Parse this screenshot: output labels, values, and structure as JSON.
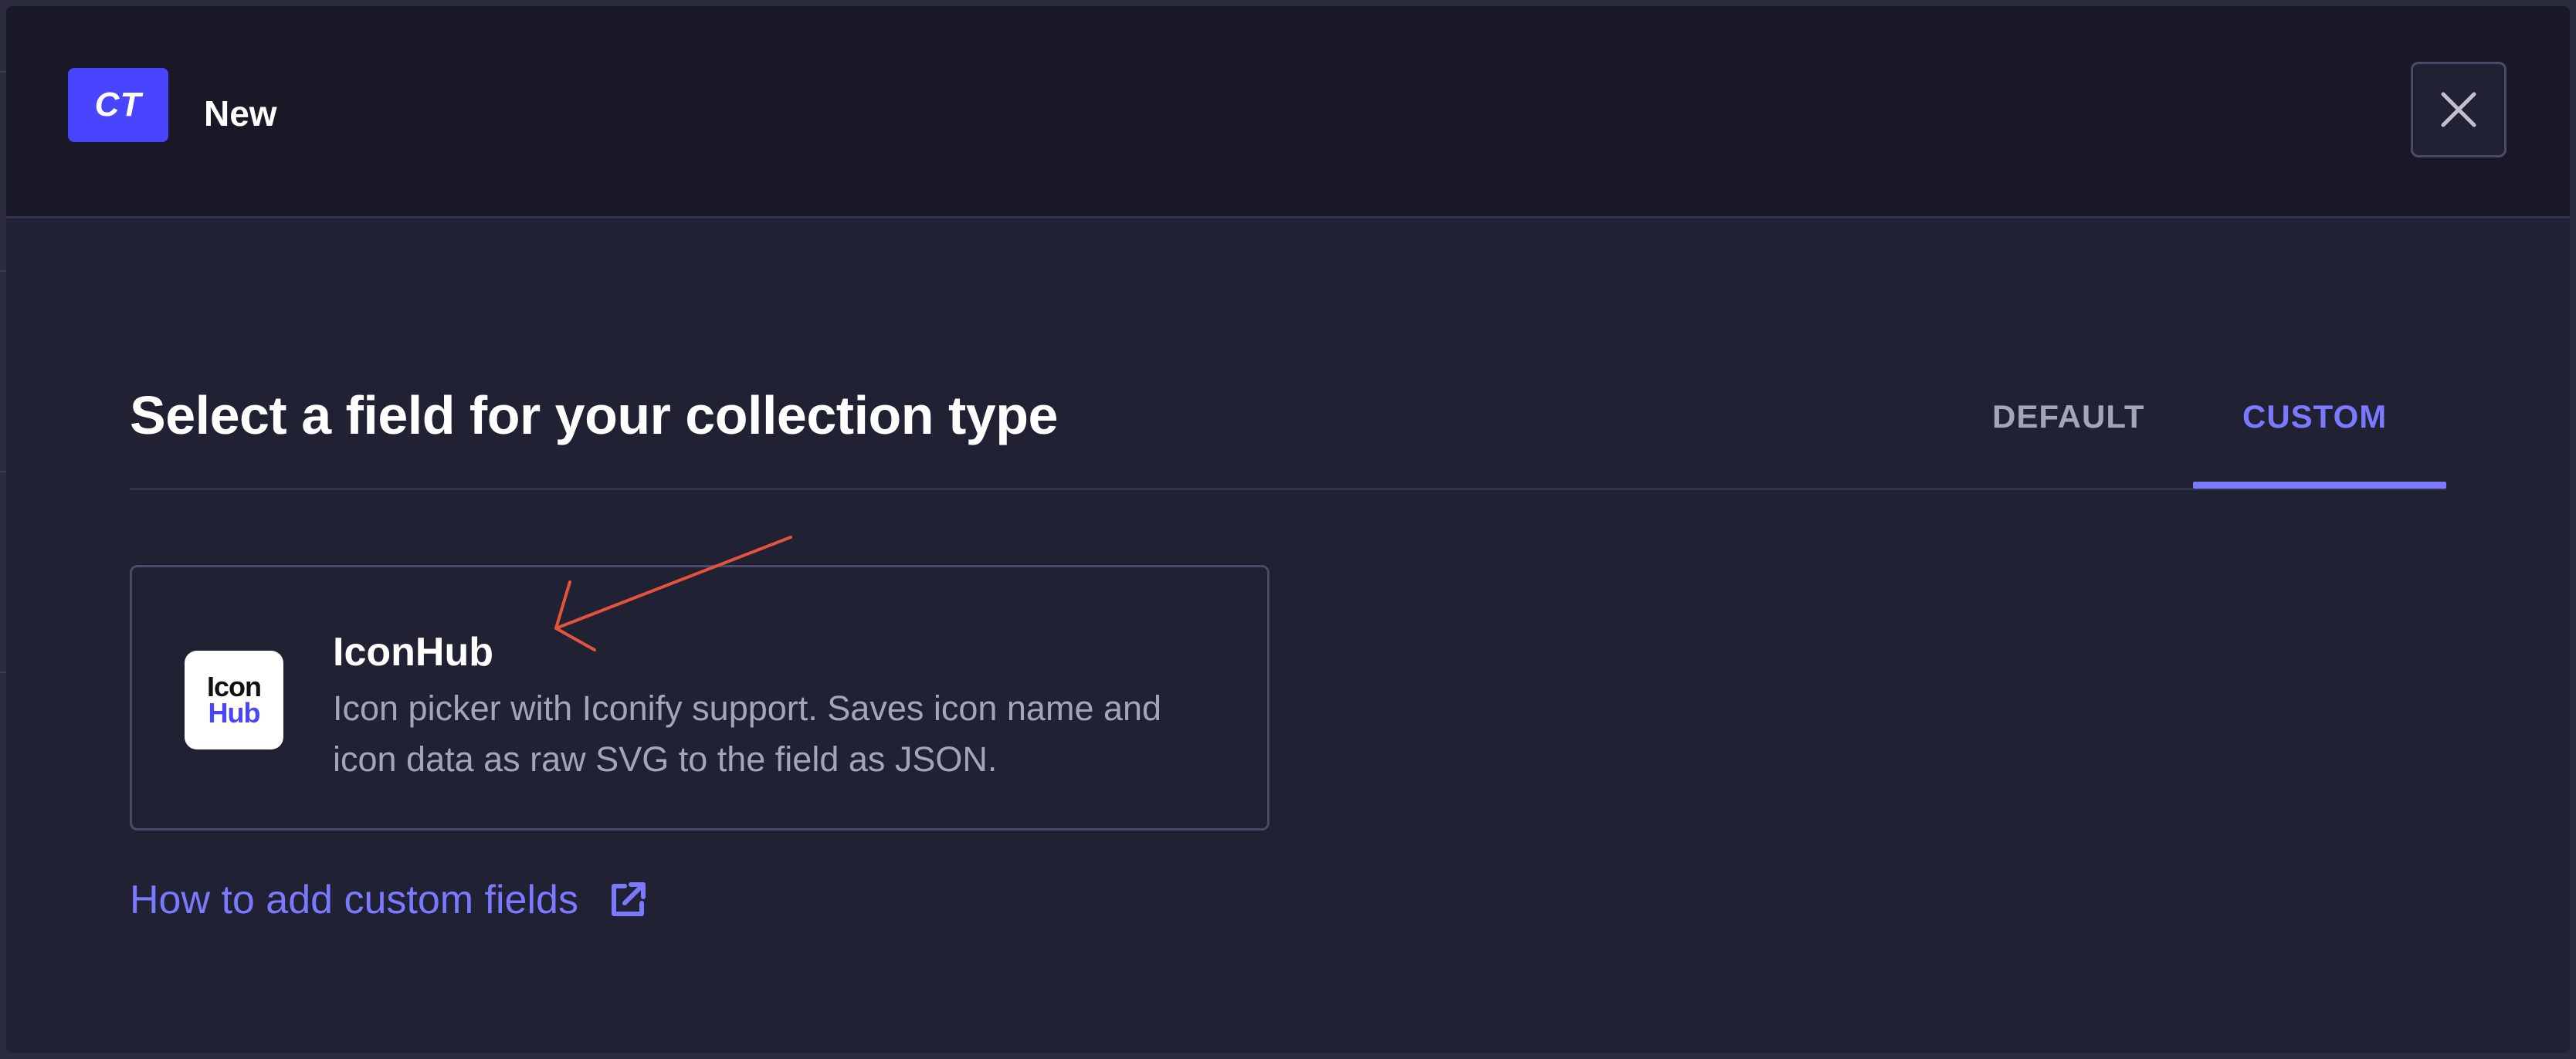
{
  "header": {
    "badge": "CT",
    "title": "New"
  },
  "main": {
    "title": "Select a field for your collection type",
    "tabs": [
      {
        "label": "DEFAULT",
        "selected": false
      },
      {
        "label": "CUSTOM",
        "selected": true
      }
    ],
    "fields": [
      {
        "name": "IconHub",
        "description": "Icon picker with Iconify support. Saves icon name and icon data as raw SVG to the field as JSON.",
        "logo_text": [
          "Icon",
          "Hub"
        ]
      }
    ],
    "help_link": "How to add custom fields"
  },
  "colors": {
    "accent": "#7b79ff",
    "badge": "#4945ff",
    "annotation": "#e5533d"
  },
  "icons": {
    "close": "close-icon",
    "external": "external-link-icon"
  }
}
